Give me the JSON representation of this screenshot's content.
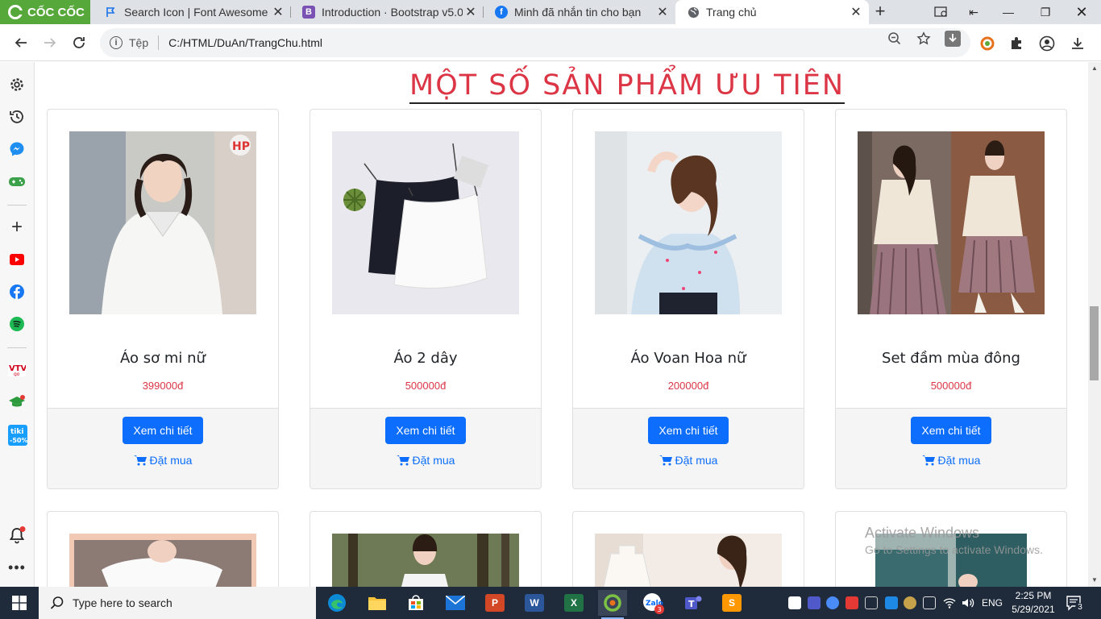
{
  "browser": {
    "brand_name": "CỐC CỐC",
    "tabs": [
      {
        "title": "Search Icon | Font Awesome",
        "icon": "flag-icon",
        "color": "#1a73e8"
      },
      {
        "title": "Introduction · Bootstrap v5.0",
        "icon": "bootstrap-icon",
        "color": "#7952b3",
        "glyph": "B"
      },
      {
        "title": "Minh đã nhắn tin cho bạn",
        "icon": "facebook-icon",
        "color": "#1877f2",
        "glyph": "f"
      },
      {
        "title": "Trang chủ",
        "icon": "globe-icon",
        "color": "#5f6368"
      }
    ],
    "address": {
      "scheme_label": "Tệp",
      "url": "C:/HTML/DuAn/TrangChu.html"
    }
  },
  "page": {
    "heading": "MỘT SỐ SẢN PHẨM ƯU TIÊN",
    "detail_label": "Xem chi tiết",
    "buy_label": "Đặt mua",
    "products": [
      {
        "name": "Áo sơ mi nữ",
        "price": "399000đ"
      },
      {
        "name": "Áo 2 dây",
        "price": "500000đ"
      },
      {
        "name": "Áo Voan Hoa nữ",
        "price": "200000đ"
      },
      {
        "name": "Set đầm mùa đông",
        "price": "500000đ"
      }
    ]
  },
  "watermark": {
    "line1": "Activate Windows",
    "line2": "Go to Settings to activate Windows."
  },
  "taskbar": {
    "search_placeholder": "Type here to search",
    "language": "ENG",
    "time": "2:25 PM",
    "date": "5/29/2021",
    "notification_count": "3",
    "zalo_badge": "3"
  },
  "colors": {
    "accent": "#0d6efd",
    "heading": "#dc3545",
    "brand": "#56a83a"
  }
}
